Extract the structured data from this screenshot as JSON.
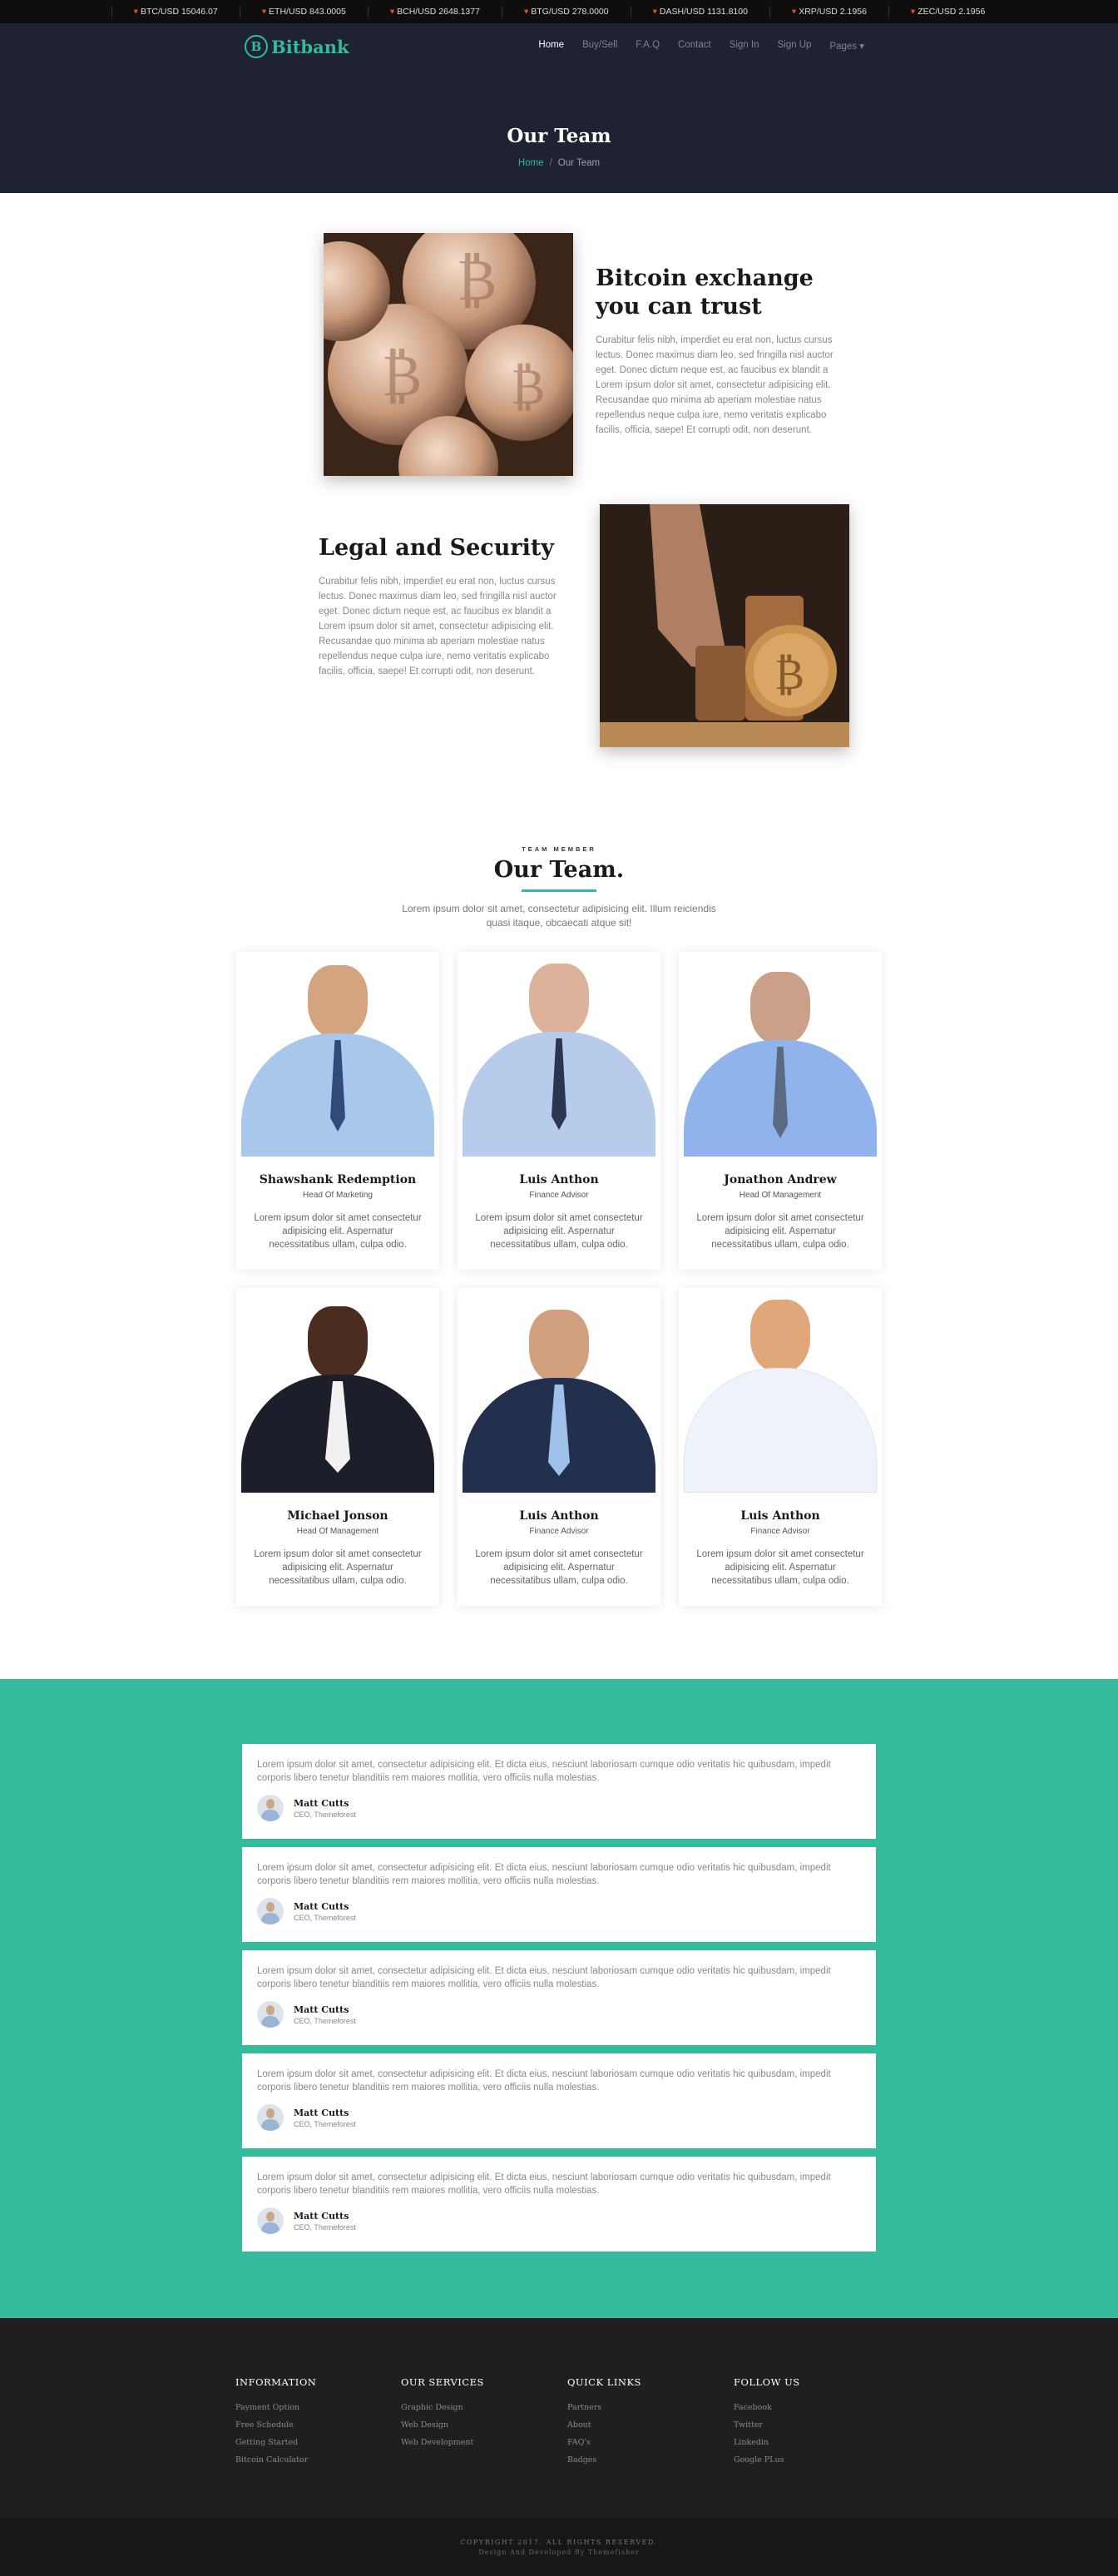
{
  "ticker": [
    {
      "label": "BTC/USD 15046.07",
      "dir": "down"
    },
    {
      "label": "ETH/USD 843.0005",
      "dir": "down"
    },
    {
      "label": "BCH/USD 2648.1377",
      "dir": "down"
    },
    {
      "label": "BTG/USD 278.0000",
      "dir": "down"
    },
    {
      "label": "DASH/USD 1131.8100",
      "dir": "down"
    },
    {
      "label": "XRP/USD 2.1956",
      "dir": "down"
    },
    {
      "label": "ZEC/USD 2.1956",
      "dir": "down"
    }
  ],
  "brand": {
    "name": "Bitbank",
    "mark": "B"
  },
  "nav": {
    "items": [
      "Home",
      "Buy/Sell",
      "F.A.Q",
      "Contact",
      "Sign In",
      "Sign Up",
      "Pages"
    ],
    "dropdown_icon": "caret-down-icon"
  },
  "page": {
    "title": "Our Team",
    "breadcrumb_home": "Home",
    "breadcrumb_sep": "/",
    "breadcrumb_current": "Our Team"
  },
  "features": [
    {
      "title": "Bitcoin exchange you can trust",
      "text": "Curabitur felis nibh, imperdiet eu erat non, luctus cursus lectus. Donec maximus diam leo, sed fringilla nisl auctor eget. Donec dictum neque est, ac faucibus ex blandit a Lorem ipsum dolor sit amet, consectetur adipisicing elit. Recusandae quo minima ab aperiam molestiae natus repellendus neque culpa iure, nemo veritatis explicabo facilis, officia, saepe! Et corrupti odit, non deserunt."
    },
    {
      "title": "Legal and Security",
      "text": "Curabitur felis nibh, imperdiet eu erat non, luctus cursus lectus. Donec maximus diam leo, sed fringilla nisl auctor eget. Donec dictum neque est, ac faucibus ex blandit a Lorem ipsum dolor sit amet, consectetur adipisicing elit. Recusandae quo minima ab aperiam molestiae natus repellendus neque culpa iure, nemo veritatis explicabo facilis, officia, saepe! Et corrupti odit, non deserunt."
    }
  ],
  "team": {
    "kicker": "TEAM MEMBER",
    "title": "Our Team.",
    "subtitle": "Lorem ipsum dolor sit amet, consectetur adipisicing elit. Illum reiciendis quasi itaque, obcaecati atque sit!",
    "members": [
      {
        "name": "Shawshank Redemption",
        "role": "Head Of Marketing",
        "desc": "Lorem ipsum dolor sit amet consectetur adipisicing elit. Aspernatur necessitatibus ullam, culpa odio."
      },
      {
        "name": "Luis Anthon",
        "role": "Finance Advisor",
        "desc": "Lorem ipsum dolor sit amet consectetur adipisicing elit. Aspernatur necessitatibus ullam, culpa odio."
      },
      {
        "name": "Jonathon Andrew",
        "role": "Head Of Management",
        "desc": "Lorem ipsum dolor sit amet consectetur adipisicing elit. Aspernatur necessitatibus ullam, culpa odio."
      },
      {
        "name": "Michael Jonson",
        "role": "Head Of Management",
        "desc": "Lorem ipsum dolor sit amet consectetur adipisicing elit. Aspernatur necessitatibus ullam, culpa odio."
      },
      {
        "name": "Luis Anthon",
        "role": "Finance Advisor",
        "desc": "Lorem ipsum dolor sit amet consectetur adipisicing elit. Aspernatur necessitatibus ullam, culpa odio."
      },
      {
        "name": "Luis Anthon",
        "role": "Finance Advisor",
        "desc": "Lorem ipsum dolor sit amet consectetur adipisicing elit. Aspernatur necessitatibus ullam, culpa odio."
      }
    ]
  },
  "testimonials": [
    {
      "quote": "Lorem ipsum dolor sit amet, consectetur adipisicing elit. Et dicta eius, nesciunt laboriosam cumque odio veritatis hic quibusdam, impedit corporis libero tenetur blanditiis rem maiores mollitia, vero officiis nulla molestias.",
      "name": "Matt Cutts",
      "role": "CEO, Themeforest"
    },
    {
      "quote": "Lorem ipsum dolor sit amet, consectetur adipisicing elit. Et dicta eius, nesciunt laboriosam cumque odio veritatis hic quibusdam, impedit corporis libero tenetur blanditiis rem maiores mollitia, vero officiis nulla molestias.",
      "name": "Matt Cutts",
      "role": "CEO, Themeforest"
    },
    {
      "quote": "Lorem ipsum dolor sit amet, consectetur adipisicing elit. Et dicta eius, nesciunt laboriosam cumque odio veritatis hic quibusdam, impedit corporis libero tenetur blanditiis rem maiores mollitia, vero officiis nulla molestias.",
      "name": "Matt Cutts",
      "role": "CEO, Themeforest"
    },
    {
      "quote": "Lorem ipsum dolor sit amet, consectetur adipisicing elit. Et dicta eius, nesciunt laboriosam cumque odio veritatis hic quibusdam, impedit corporis libero tenetur blanditiis rem maiores mollitia, vero officiis nulla molestias.",
      "name": "Matt Cutts",
      "role": "CEO, Themeforest"
    },
    {
      "quote": "Lorem ipsum dolor sit amet, consectetur adipisicing elit. Et dicta eius, nesciunt laboriosam cumque odio veritatis hic quibusdam, impedit corporis libero tenetur blanditiis rem maiores mollitia, vero officiis nulla molestias.",
      "name": "Matt Cutts",
      "role": "CEO, Themeforest"
    }
  ],
  "footer": {
    "columns": [
      {
        "title": "INFORMATION",
        "links": [
          "Payment Option",
          "Free Schedule",
          "Getting Started",
          "Bitcoin Calculator"
        ]
      },
      {
        "title": "OUR SERVICES",
        "links": [
          "Graphic Design",
          "Web Design",
          "Web Development"
        ]
      },
      {
        "title": "QUICK LINKS",
        "links": [
          "Partners",
          "About",
          "FAQ's",
          "Badges"
        ]
      },
      {
        "title": "FOLLOW US",
        "links": [
          "Facebook",
          "Twitter",
          "Linkedin",
          "Google PLus"
        ]
      }
    ],
    "copyright": "COPYRIGHT 2017. ALL RIGHTS RESERVED.",
    "credit": "Design And Developed By Themefisher"
  },
  "colors": {
    "accent": "#33bb9b",
    "header_bg": "#1e2233",
    "ticker_bg": "#0e0e0e",
    "footer_bg": "#1f1f20",
    "down": "#e84c3d"
  }
}
